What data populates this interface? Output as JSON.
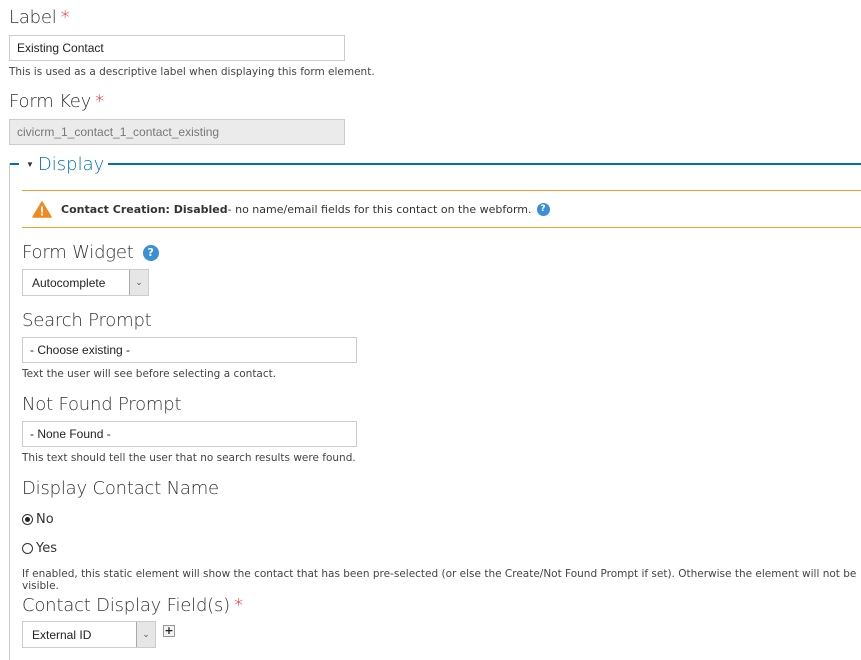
{
  "label_field": {
    "label": "Label",
    "required_mark": "*",
    "value": "Existing Contact",
    "description": "This is used as a descriptive label when displaying this form element."
  },
  "form_key_field": {
    "label": "Form Key",
    "required_mark": "*",
    "value": "civicrm_1_contact_1_contact_existing"
  },
  "display_fieldset": {
    "legend": "Display",
    "legend_toggle_icon": "triangle-down",
    "warning": {
      "icon": "warning-triangle-icon",
      "title": "Contact Creation: Disabled",
      "text": " - no name/email fields for this contact on the webform.",
      "help_icon": "?"
    },
    "form_widget": {
      "label": "Form Widget",
      "help_icon": "?",
      "selected": "Autocomplete"
    },
    "search_prompt": {
      "label": "Search Prompt",
      "value": "- Choose existing -",
      "description": "Text the user will see before selecting a contact."
    },
    "not_found_prompt": {
      "label": "Not Found Prompt",
      "value": "- None Found -",
      "description": "This text should tell the user that no search results were found."
    },
    "display_contact_name": {
      "label": "Display Contact Name",
      "options": [
        {
          "label": "No",
          "checked": true
        },
        {
          "label": "Yes",
          "checked": false
        }
      ],
      "description": "If enabled, this static element will show the contact that has been pre-selected (or else the Create/Not Found Prompt if set). Otherwise the element will not be visible."
    },
    "contact_display_fields": {
      "label": "Contact Display Field(s)",
      "required_mark": "*",
      "selected": "External ID",
      "add_label": "+"
    }
  },
  "colors": {
    "accent": "#0071b8",
    "warning_border": "#f0a030",
    "warning_icon": "#f28a1b",
    "required": "#e00000",
    "help_icon": "#3b8fd4"
  }
}
